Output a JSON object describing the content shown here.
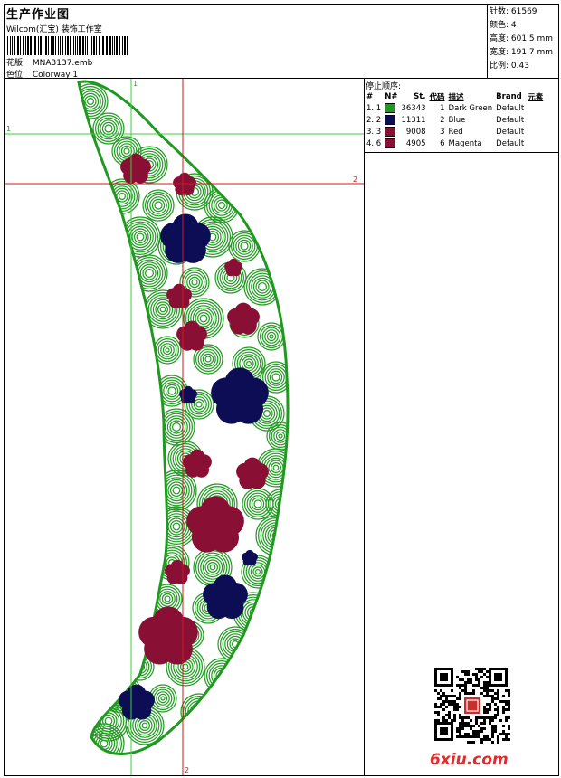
{
  "header": {
    "title": "生产作业图",
    "subtitle": "Wilcom(汇宝) 装饰工作室",
    "design_label": "花版:",
    "design_value": "MNA3137.emb",
    "colorway_label": "色位:",
    "colorway_value": "Colorway 1"
  },
  "stats": {
    "stitches": "针数: 61569",
    "colors": "颜色: 4",
    "height": "高度: 601.5 mm",
    "width": "宽度: 191.7 mm",
    "scale": "比例: 0.43"
  },
  "stop_panel": {
    "title": "停止顺序:",
    "headers": [
      "#",
      "N#",
      "St.",
      "代码",
      "描述",
      "Brand",
      "元素"
    ],
    "rows": [
      {
        "idx": "1. 1",
        "color": "#1f9a1f",
        "st": "36343",
        "code": "1",
        "desc": "Dark Green",
        "brand": "Default"
      },
      {
        "idx": "2. 2",
        "color": "#0d0d55",
        "st": "11311",
        "code": "2",
        "desc": "Blue",
        "brand": "Default"
      },
      {
        "idx": "3. 3",
        "color": "#8a0f35",
        "st": "9008",
        "code": "3",
        "desc": "Red",
        "brand": "Default"
      },
      {
        "idx": "4. 6",
        "color": "#8a0f35",
        "st": "4905",
        "code": "6",
        "desc": "Magenta",
        "brand": "Default"
      }
    ]
  },
  "guides": {
    "green_v": "1",
    "green_h": "1",
    "red_v": "2",
    "red_h": "2"
  },
  "palette": {
    "green": "#1f9a1f",
    "navy": "#0d0d55",
    "maroon": "#8a0f35",
    "guide_green": "#3bd03b",
    "guide_red": "#d01818"
  },
  "watermark": "6xiu.com"
}
